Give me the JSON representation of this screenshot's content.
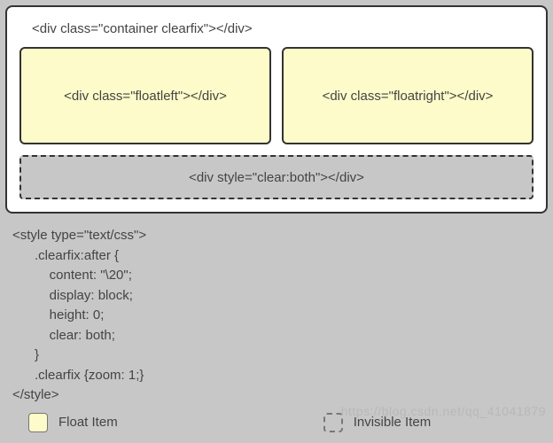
{
  "container": {
    "label": "<div class=\"container clearfix\"></div>",
    "float_left_label": "<div class=\"floatleft\"></div>",
    "float_right_label": "<div class=\"floatright\"></div>",
    "clear_label": "<div style=\"clear:both\"></div>"
  },
  "code": "<style type=\"text/css\">\n      .clearfix:after {\n          content: \"\\20\";\n          display: block;\n          height: 0;\n          clear: both;\n      }\n      .clearfix {zoom: 1;}\n</style>",
  "legend": {
    "float_label": "Float Item",
    "invisible_label": "Invisible Item"
  },
  "watermark": "https://blog.csdn.net/qq_41041879"
}
